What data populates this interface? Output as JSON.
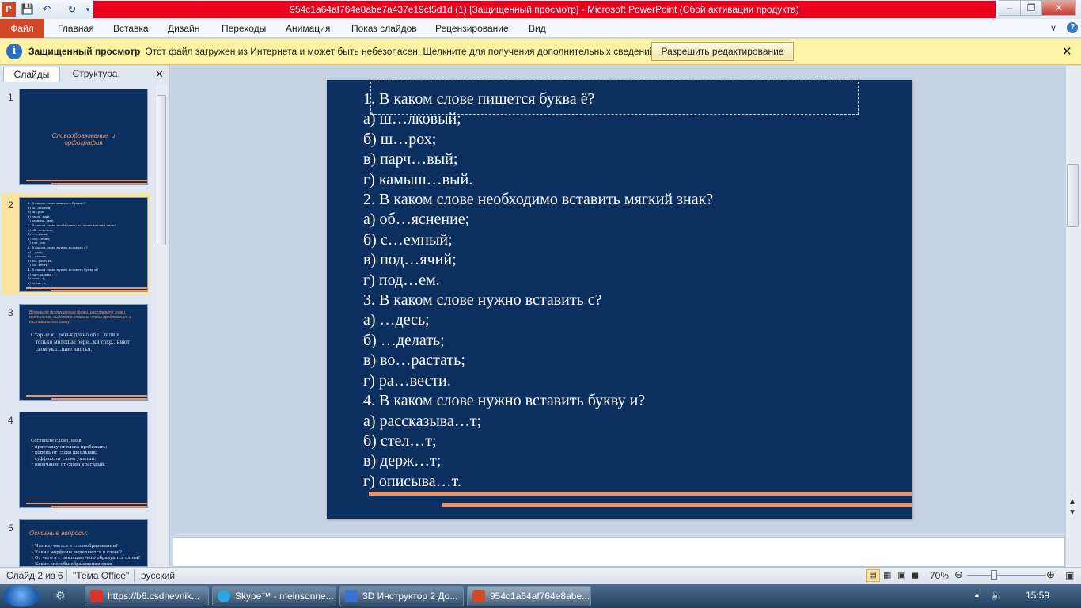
{
  "window": {
    "title": "954c1a64af764e8abe7a437e19cf5d1d (1) [Защищенный просмотр]  -  Microsoft PowerPoint (Сбой активации продукта)"
  },
  "ribbon": {
    "file_tab": "Файл",
    "tabs": [
      "Главная",
      "Вставка",
      "Дизайн",
      "Переходы",
      "Анимация",
      "Показ слайдов",
      "Рецензирование",
      "Вид"
    ]
  },
  "protected_view": {
    "label": "Защищенный просмотр",
    "message": "Этот файл загружен из Интернета и может быть небезопасен. Щелкните для получения дополнительных сведений.",
    "enable_button": "Разрешить редактирование"
  },
  "left_pane": {
    "tab_slides": "Слайды",
    "tab_outline": "Структура",
    "slides": [
      {
        "num": "1",
        "title": "Словообразование  и\nорфография"
      },
      {
        "num": "2",
        "text": "1. В каком слове пишется буква ё?\nа) ш...лковый;\nб) ш...рох;\nв) парч...вый;\nг) камыш...вый.\n2. В каком слове необходимо вставить мягкий знак?\nа) об...яснение;\nб) с...емный;\nв) под...ячий;\nг) под...ем.\n3. В каком слове нужно вставить с?\nа) ...десь;\nб) ...делать;\nв) во...растать;\nг) ра...вести.\n4. В каком слове нужно вставить букву и?\nа) рассказыва...т;\nб) стел...т;\nв) держ...т;\nг) описыва...т."
      },
      {
        "num": "3",
        "title": "Вставьте пропущенные буквы, расставьте знаки\nпрепинания, выделите главные члены предложения и\nсоставьте его схему",
        "text": "Старые к...ревья давно обл...тели и\n   только молодые бере...ки сохр...няют\n   свои укл...шие листья."
      },
      {
        "num": "4",
        "text": "Составьте слово, взяв:\n• приставку от слова пробежать;\n• корень от слова школьник;\n• суффикс от слова умелый;\n• окончание от слова красивый."
      },
      {
        "num": "5",
        "title": "Основные вопросы:",
        "text": "• Что изучается в словообразовании?\n• Какие морфемы выделяются в слове?\n• От чего и с помощью чего образуются слова?\n• Какие способы образования слов"
      }
    ]
  },
  "slide": {
    "lines": [
      "1. В каком слове пишется буква ё?",
      "а) ш…лковый;",
      "б) ш…рох;",
      "в) парч…вый;",
      "г) камыш…вый.",
      "2. В каком слове необходимо вставить мягкий знак?",
      "а) об…яснение;",
      "б) с…емный;",
      "в) под…ячий;",
      "г) под…ем.",
      "3. В каком слове нужно вставить с?",
      "а) …десь;",
      "б) …делать;",
      "в) во…растать;",
      "г) ра…вести.",
      "4. В каком слове нужно вставить букву и?",
      "а) рассказыва…т;",
      "б) стел…т;",
      "в) держ…т;",
      "г) описыва…т."
    ]
  },
  "status": {
    "slide_info": "Слайд 2 из 6",
    "theme": "\"Тема Office\"",
    "language": "русский",
    "zoom": "70%"
  },
  "taskbar": {
    "items": [
      {
        "label": "https://b6.csdnevnik...",
        "icon_color": "#d9342b"
      },
      {
        "label": "Skype™ - meinsonne...",
        "icon_color": "#2aa6e0"
      },
      {
        "label": "3D Инструктор 2 До...",
        "icon_color": "#3b6fd1"
      },
      {
        "label": "954c1a64af764e8abe...",
        "icon_color": "#d24726"
      }
    ],
    "clock": "15:59"
  }
}
